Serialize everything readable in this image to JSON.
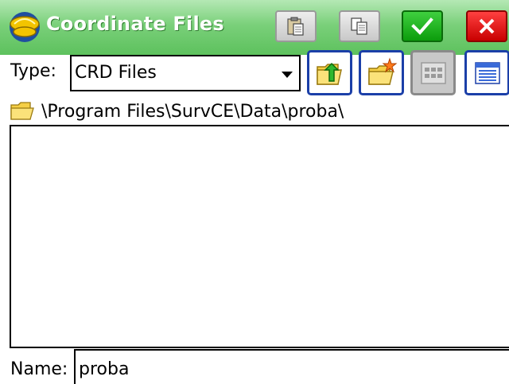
{
  "window": {
    "title": "Coordinate Files",
    "icons": [
      "app-logo-icon",
      "paste-icon",
      "copy-icon",
      "checkmark-icon",
      "close-icon"
    ]
  },
  "toolbar": {
    "type_label": "Type:",
    "type_selected": "CRD Files",
    "buttons": [
      "folder-up-icon",
      "new-folder-icon",
      "list-view-icon",
      "detail-view-icon"
    ]
  },
  "path": {
    "current": "\\Program Files\\SurvCE\\Data\\proba\\"
  },
  "file_list": {
    "items": []
  },
  "name_field": {
    "label": "Name:",
    "value": "proba"
  },
  "colors": {
    "title_bar": "#5dc15d",
    "ok_button": "#0c9c0c",
    "cancel_button": "#c80000",
    "active_border": "#1b3fa8"
  }
}
